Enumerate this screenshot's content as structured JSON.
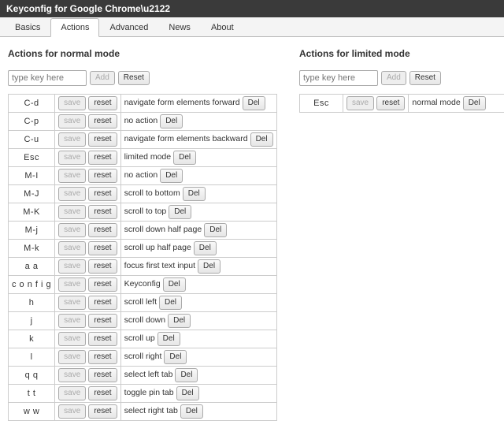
{
  "title": "Keyconfig for Google Chrome\\u2122",
  "tabs": [
    "Basics",
    "Actions",
    "Advanced",
    "News",
    "About"
  ],
  "activeTab": "Actions",
  "addPlaceholder": "type key here",
  "addBtn": "Add",
  "resetBtn": "Reset",
  "saveBtn": "save",
  "rowResetBtn": "reset",
  "delBtn": "Del",
  "normal": {
    "heading": "Actions for normal mode",
    "rows": [
      {
        "key": "C-d",
        "action": "navigate form elements forward"
      },
      {
        "key": "C-p",
        "action": "no action"
      },
      {
        "key": "C-u",
        "action": "navigate form elements backward"
      },
      {
        "key": "Esc",
        "action": "limited mode"
      },
      {
        "key": "M-I",
        "action": "no action"
      },
      {
        "key": "M-J",
        "action": "scroll to bottom"
      },
      {
        "key": "M-K",
        "action": "scroll to top"
      },
      {
        "key": "M-j",
        "action": "scroll down half page"
      },
      {
        "key": "M-k",
        "action": "scroll up half page"
      },
      {
        "key": "a a",
        "action": "focus first text input"
      },
      {
        "key": "c o n f i g",
        "action": "Keyconfig"
      },
      {
        "key": "h",
        "action": "scroll left"
      },
      {
        "key": "j",
        "action": "scroll down"
      },
      {
        "key": "k",
        "action": "scroll up"
      },
      {
        "key": "l",
        "action": "scroll right"
      },
      {
        "key": "q q",
        "action": "select left tab"
      },
      {
        "key": "t t",
        "action": "toggle pin tab"
      },
      {
        "key": "w w",
        "action": "select right tab"
      }
    ]
  },
  "limited": {
    "heading": "Actions for limited mode",
    "rows": [
      {
        "key": "Esc",
        "action": "normal mode"
      }
    ]
  }
}
